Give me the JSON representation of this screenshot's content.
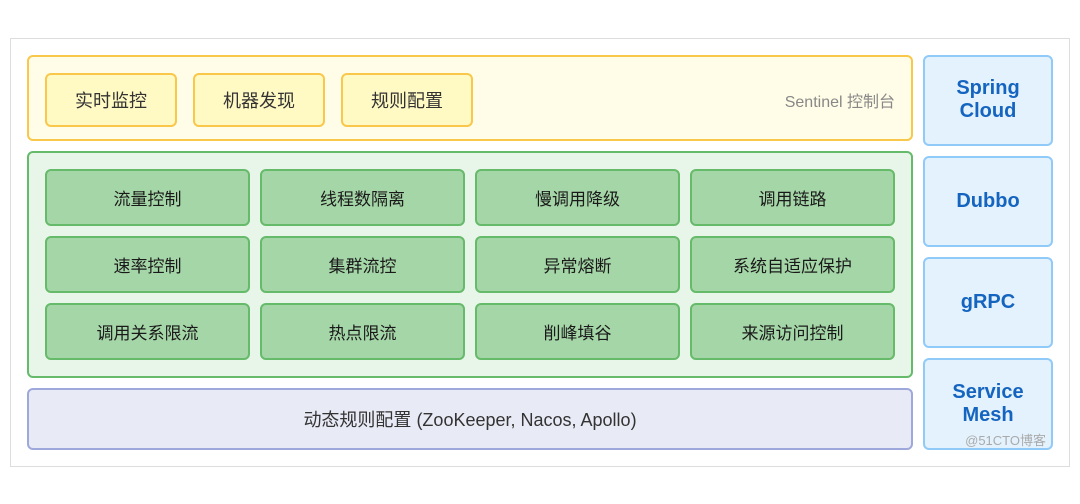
{
  "sentinel": {
    "section_bg": "#fffde7",
    "boxes": [
      "实时监控",
      "机器发现",
      "规则配置"
    ],
    "label": "Sentinel 控制台"
  },
  "core": {
    "section_bg": "#e8f5e9",
    "cells": [
      "流量控制",
      "线程数隔离",
      "慢调用降级",
      "调用链路",
      "速率控制",
      "集群流控",
      "异常熔断",
      "系统自适应保护",
      "调用关系限流",
      "热点限流",
      "削峰填谷",
      "来源访问控制"
    ]
  },
  "dynamic": {
    "label": "动态规则配置 (ZooKeeper, Nacos, Apollo)"
  },
  "integrations": [
    "Spring\nCloud",
    "Dubbo",
    "gRPC",
    "Service\nMesh"
  ],
  "watermark": "@51CTO博客"
}
